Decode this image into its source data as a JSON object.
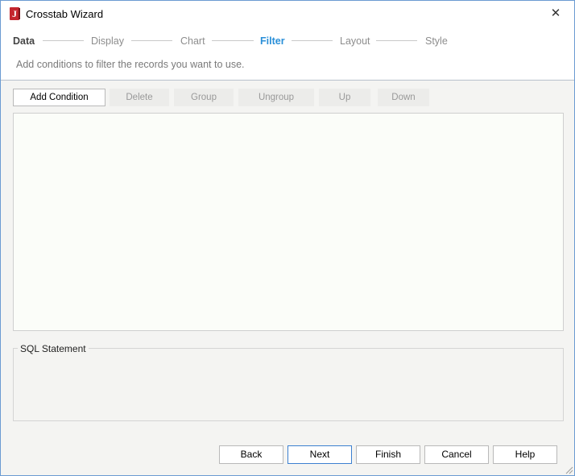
{
  "window": {
    "title": "Crosstab Wizard"
  },
  "steps": [
    {
      "label": "Data",
      "state": "done"
    },
    {
      "label": "Display",
      "state": "pending"
    },
    {
      "label": "Chart",
      "state": "pending"
    },
    {
      "label": "Filter",
      "state": "active"
    },
    {
      "label": "Layout",
      "state": "pending"
    },
    {
      "label": "Style",
      "state": "pending"
    }
  ],
  "description": "Add conditions to filter the records you want to use.",
  "toolbar": {
    "add_condition": "Add Condition",
    "delete": "Delete",
    "group": "Group",
    "ungroup": "Ungroup",
    "up": "Up",
    "down": "Down"
  },
  "sql": {
    "label": "SQL Statement",
    "value": ""
  },
  "footer": {
    "back": "Back",
    "next": "Next",
    "finish": "Finish",
    "cancel": "Cancel",
    "help": "Help"
  },
  "colors": {
    "active_step": "#2a8fd8",
    "app_icon": "#c4262e",
    "window_border": "#6b9bd2"
  }
}
